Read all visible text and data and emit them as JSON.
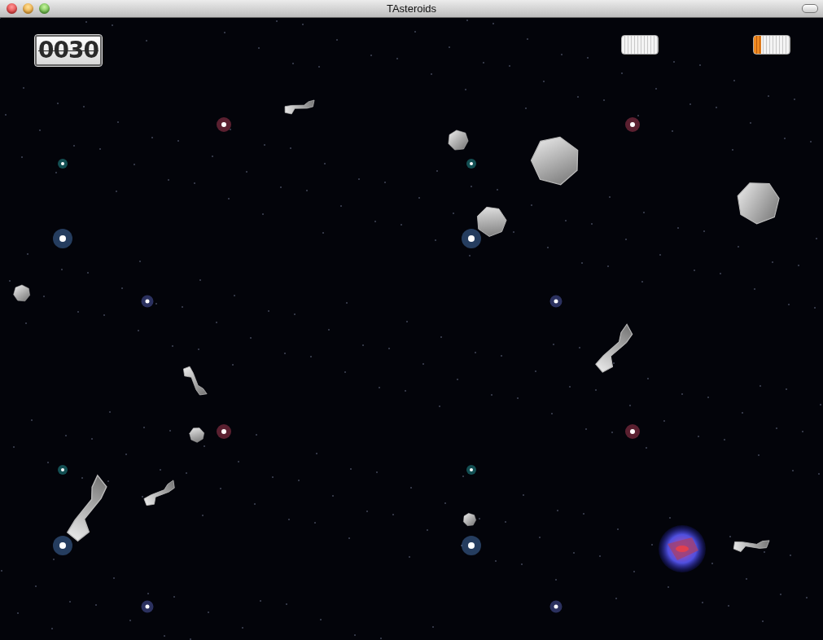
{
  "window": {
    "title": "TAsteroids"
  },
  "score": "0030",
  "meters": [
    {
      "level": 0
    },
    {
      "level": 0.2
    }
  ]
}
